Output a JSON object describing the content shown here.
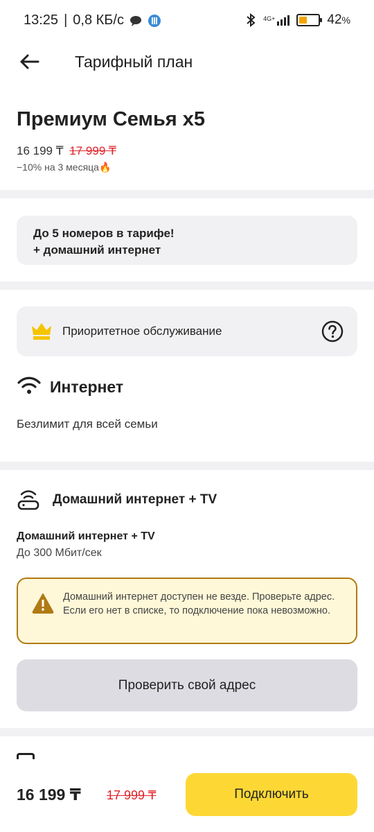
{
  "status_bar": {
    "time": "13:25",
    "network_speed": "0,8 КБ/с",
    "signal_label": "4G+",
    "battery_percent": "42",
    "battery_suffix": "%"
  },
  "app_bar": {
    "title": "Тарифный план"
  },
  "plan": {
    "name": "Премиум Семья х5",
    "price": "16 199 ₸",
    "old_price": "17 999 ₸",
    "discount": "−10% на 3 месяца🔥"
  },
  "family_card": {
    "line1": "До 5 номеров в тарифе!",
    "line2": "+ домашний интернет"
  },
  "priority": {
    "label": "Приоритетное обслуживание",
    "icon": "crown-icon",
    "help_icon": "help-icon",
    "crown_color": "#f5c400"
  },
  "internet": {
    "title": "Интернет",
    "subtitle": "Безлимит для всей семьи"
  },
  "home_internet": {
    "title": "Домашний интернет + TV",
    "name": "Домашний интернет + TV",
    "speed": "До 300 Мбит/сек"
  },
  "warning": {
    "text": "Домашний интернет доступен не везде. Проверьте адрес. Если его нет в списке, то подключение пока невозможно.",
    "icon_color": "#b07a14",
    "bg_color": "#fff8d8"
  },
  "check_address_button": "Проверить свой адрес",
  "bottom": {
    "price": "16 199 ₸",
    "old_price": "17 999 ₸",
    "connect_button": "Подключить",
    "accent_color": "#fdd835"
  }
}
